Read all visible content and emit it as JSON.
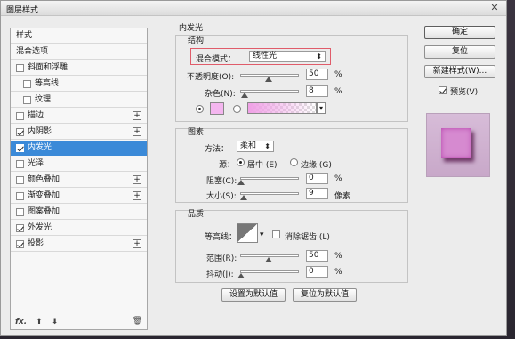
{
  "window": {
    "title": "图层样式",
    "close_glyph": "✕"
  },
  "left_list": {
    "items": [
      {
        "label": "样式",
        "checkbox": false,
        "checked": false,
        "plus": false,
        "selected": false
      },
      {
        "label": "混合选项",
        "checkbox": false,
        "checked": false,
        "plus": false,
        "selected": false
      },
      {
        "label": "斜面和浮雕",
        "checkbox": true,
        "checked": false,
        "plus": false,
        "selected": false
      },
      {
        "label": "等高线",
        "checkbox": true,
        "checked": false,
        "plus": false,
        "selected": false,
        "indent": true
      },
      {
        "label": "纹理",
        "checkbox": true,
        "checked": false,
        "plus": false,
        "selected": false,
        "indent": true
      },
      {
        "label": "描边",
        "checkbox": true,
        "checked": false,
        "plus": true,
        "selected": false
      },
      {
        "label": "内阴影",
        "checkbox": true,
        "checked": true,
        "plus": true,
        "selected": false
      },
      {
        "label": "内发光",
        "checkbox": true,
        "checked": true,
        "plus": false,
        "selected": true
      },
      {
        "label": "光泽",
        "checkbox": true,
        "checked": false,
        "plus": false,
        "selected": false
      },
      {
        "label": "颜色叠加",
        "checkbox": true,
        "checked": false,
        "plus": true,
        "selected": false
      },
      {
        "label": "渐变叠加",
        "checkbox": true,
        "checked": false,
        "plus": true,
        "selected": false
      },
      {
        "label": "图案叠加",
        "checkbox": true,
        "checked": false,
        "plus": false,
        "selected": false
      },
      {
        "label": "外发光",
        "checkbox": true,
        "checked": true,
        "plus": false,
        "selected": false
      },
      {
        "label": "投影",
        "checkbox": true,
        "checked": true,
        "plus": true,
        "selected": false
      }
    ],
    "plus_glyph": "+",
    "footer": {
      "fx": "fx.",
      "up": "⬆",
      "down": "⬇",
      "trash": "🗑"
    }
  },
  "panel": {
    "heading": "内发光",
    "structure": {
      "title": "结构",
      "blend_mode_label": "混合模式：",
      "blend_mode_value": "线性光",
      "opacity_label": "不透明度(O):",
      "opacity_value": "50",
      "noise_label": "杂色(N):",
      "noise_value": "8",
      "percent": "%",
      "caret": "⬍"
    },
    "elements": {
      "title": "图素",
      "method_label": "方法：",
      "method_value": "柔和",
      "source_label": "源：",
      "source_center": "居中 (E)",
      "source_edge": "边缘 (G)",
      "source_selected": "center",
      "choke_label": "阻塞(C):",
      "choke_value": "0",
      "size_label": "大小(S):",
      "size_value": "9",
      "size_unit": "像素",
      "percent": "%"
    },
    "quality": {
      "title": "品质",
      "contour_label": "等高线：",
      "antialias_label": "消除锯齿 (L)",
      "antialias_checked": false,
      "range_label": "范围(R):",
      "range_value": "50",
      "jitter_label": "抖动(J):",
      "jitter_value": "0",
      "percent": "%"
    },
    "buttons": {
      "set_default": "设置为默认值",
      "reset_default": "复位为默认值"
    }
  },
  "right": {
    "ok": "确定",
    "reset": "复位",
    "new_style": "新建样式(W)...",
    "preview_label": "预览(V)",
    "preview_checked": true
  },
  "colors": {
    "glow_color": "#f4b6ef",
    "selection_blue": "#3b8ad8",
    "highlight_red": "#e05c6a",
    "preview_fill": "#d68ad0"
  }
}
